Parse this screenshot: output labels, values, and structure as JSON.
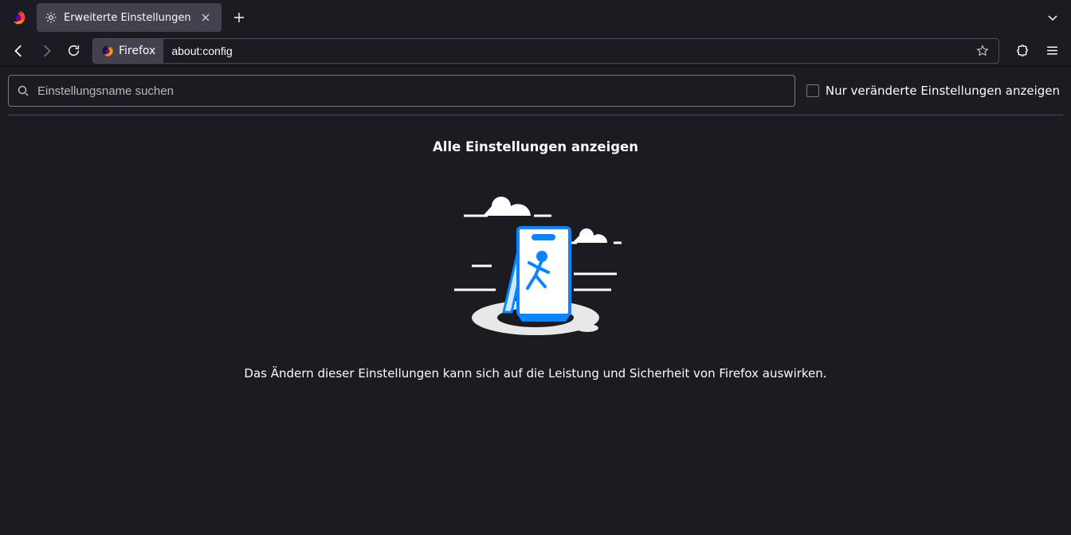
{
  "tab": {
    "title": "Erweiterte Einstellungen"
  },
  "urlbar": {
    "identity_label": "Firefox",
    "url": "about:config"
  },
  "search": {
    "placeholder": "Einstellungsname suchen"
  },
  "filter_checkbox": {
    "label": "Nur veränderte Einstellungen anzeigen"
  },
  "main": {
    "heading": "Alle Einstellungen anzeigen",
    "warning": "Das Ändern dieser Einstellungen kann sich auf die Leistung und Sicherheit von Firefox auswirken."
  }
}
